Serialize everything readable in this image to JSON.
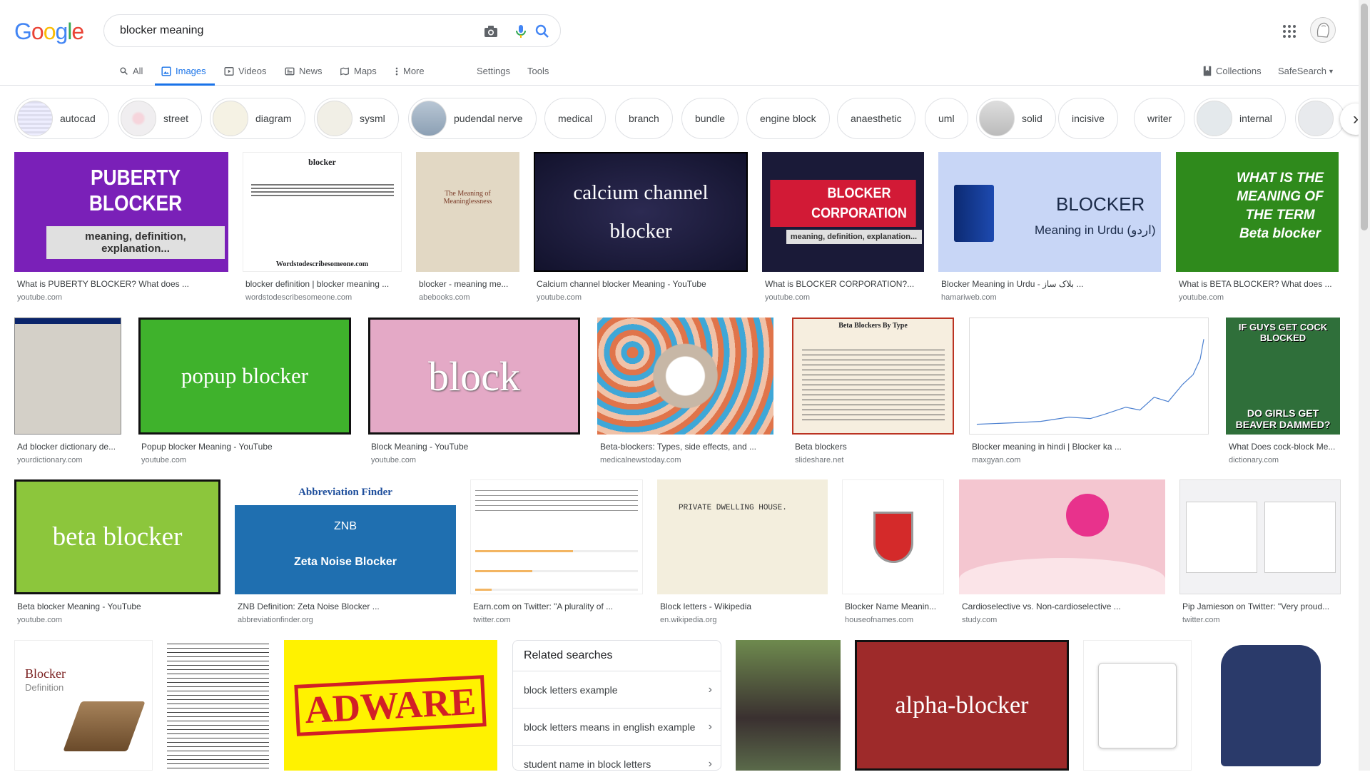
{
  "logo": {
    "letters": [
      "G",
      "o",
      "o",
      "g",
      "l",
      "e"
    ],
    "colors": [
      "#4285f4",
      "#ea4335",
      "#fbbc05",
      "#4285f4",
      "#34a853",
      "#ea4335"
    ]
  },
  "search": {
    "value": "blocker meaning"
  },
  "tabs": [
    {
      "label": "All",
      "icon": "search-icon"
    },
    {
      "label": "Images",
      "icon": "image-icon",
      "active": true
    },
    {
      "label": "Videos",
      "icon": "video-icon"
    },
    {
      "label": "News",
      "icon": "news-icon"
    },
    {
      "label": "Maps",
      "icon": "map-icon"
    },
    {
      "label": "More",
      "icon": "more-icon"
    },
    {
      "label": "Settings"
    },
    {
      "label": "Tools"
    }
  ],
  "right_tabs": {
    "collections": "Collections",
    "safesearch": "SafeSearch"
  },
  "chips": [
    {
      "label": "autocad",
      "thumb": true
    },
    {
      "label": "street",
      "thumb": true
    },
    {
      "label": "diagram",
      "thumb": true
    },
    {
      "label": "sysml",
      "thumb": true
    },
    {
      "label": "pudendal nerve",
      "thumb": true
    },
    {
      "label": "medical"
    },
    {
      "label": "branch"
    },
    {
      "label": "bundle"
    },
    {
      "label": "engine block"
    },
    {
      "label": "anaesthetic"
    },
    {
      "label": "uml"
    },
    {
      "label": "solid",
      "thumb": true
    },
    {
      "label": "incisive"
    },
    {
      "label": "writer"
    },
    {
      "label": "internal",
      "thumb": true
    }
  ],
  "results": {
    "r1": {
      "title": "What is PUBERTY BLOCKER? What does ...",
      "site": "youtube.com",
      "img_text": "PUBERTY BLOCKER",
      "img_sub": "meaning, definition, explanation..."
    },
    "r2": {
      "title": "blocker definition | blocker meaning ...",
      "site": "wordstodescribesomeone.com",
      "img_text": "blocker",
      "img_sub": "Wordstodescribesomeone.com"
    },
    "r3": {
      "title": "blocker - meaning me...",
      "site": "abebooks.com",
      "img_text": "The Meaning of Meaninglessness"
    },
    "r4": {
      "title": "Calcium channel blocker Meaning - YouTube",
      "site": "youtube.com",
      "img_text": "calcium channel blocker"
    },
    "r5": {
      "title": "What is BLOCKER CORPORATION?...",
      "site": "youtube.com",
      "img_text": "BLOCKER CORPORATION",
      "img_sub": "meaning, definition, explanation..."
    },
    "r6": {
      "title": "Blocker Meaning in Urdu - بلاک ساز ...",
      "site": "hamariweb.com",
      "img_text": "BLOCKER",
      "img_sub": "Meaning in Urdu (اردو)"
    },
    "r7": {
      "title": "What is BETA BLOCKER? What does ...",
      "site": "youtube.com",
      "img_text": "WHAT IS THE MEANING OF THE TERM Beta blocker"
    },
    "r8": {
      "title": "Ad blocker dictionary de...",
      "site": "yourdictionary.com"
    },
    "r9": {
      "title": "Popup blocker Meaning - YouTube",
      "site": "youtube.com",
      "img_text": "popup blocker"
    },
    "r10": {
      "title": "Block Meaning - YouTube",
      "site": "youtube.com",
      "img_text": "block"
    },
    "r11": {
      "title": "Beta-blockers: Types, side effects, and ...",
      "site": "medicalnewstoday.com"
    },
    "r12": {
      "title": "Beta blockers",
      "site": "slideshare.net",
      "img_text": "Beta Blockers By Type"
    },
    "r13": {
      "title": "Blocker meaning in hindi | Blocker ka ...",
      "site": "maxgyan.com"
    },
    "r14": {
      "title": "What Does cock-block Me...",
      "site": "dictionary.com",
      "img_text": "IF GUYS GET COCK BLOCKED",
      "img_sub": "DO GIRLS GET BEAVER DAMMED?"
    },
    "r15": {
      "title": "Beta blocker Meaning - YouTube",
      "site": "youtube.com",
      "img_text": "beta blocker"
    },
    "r16": {
      "title": "ZNB Definition: Zeta Noise Blocker ...",
      "site": "abbreviationfinder.org",
      "img_text": "ZNB",
      "img_sub": "Zeta Noise Blocker"
    },
    "r17": {
      "title": "Earn.com on Twitter: \"A plurality of ...",
      "site": "twitter.com"
    },
    "r18": {
      "title": "Block letters - Wikipedia",
      "site": "en.wikipedia.org",
      "img_text": "PRIVATE DWELLING HOUSE."
    },
    "r19": {
      "title": "Blocker Name Meanin...",
      "site": "houseofnames.com"
    },
    "r20": {
      "title": "Cardioselective vs. Non-cardioselective ...",
      "site": "study.com"
    },
    "r21": {
      "title": "Pip Jamieson on Twitter: \"Very proud...",
      "site": "twitter.com"
    },
    "r22": {
      "img_text": "Blocker",
      "img_sub": "Definition"
    },
    "r23": {
      "img_text": "ADWARE"
    },
    "r24": {
      "img_text": "alpha-blocker"
    }
  },
  "related": {
    "heading": "Related searches",
    "items": [
      "block letters example",
      "block letters means in english example",
      "student name in block letters"
    ]
  }
}
